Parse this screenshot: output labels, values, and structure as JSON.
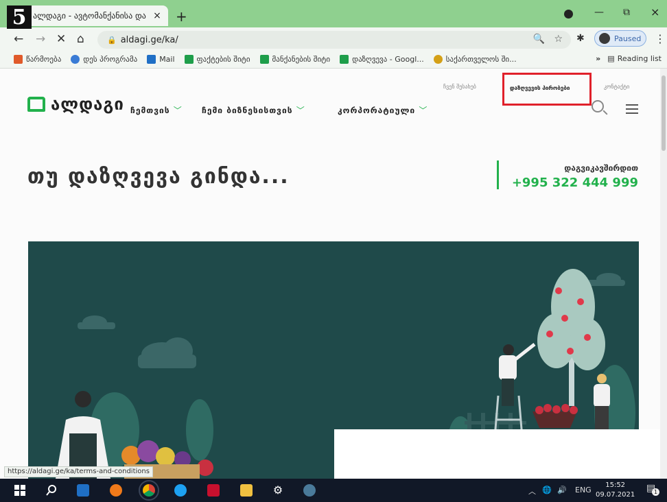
{
  "step_badge": "5",
  "browser": {
    "tab_title": "ალდაგი - ავტომანქანისა და",
    "tab_close": "×",
    "new_tab": "+",
    "url": "aldagi.ge/ka/",
    "profile_status": "Paused",
    "window_min": "—",
    "window_max": "⧉",
    "window_close": "×"
  },
  "bookmarks": {
    "items": [
      {
        "label": "წარმოება",
        "color": "#e05a2a"
      },
      {
        "label": "დეს პროგრამა",
        "color": "#3a7bd5"
      },
      {
        "label": "Mail",
        "color": "#1f6fc5"
      },
      {
        "label": "ფაქტების შიტი",
        "color": "#1e9e4a"
      },
      {
        "label": "მანქანების შიტი",
        "color": "#1e9e4a"
      },
      {
        "label": "დაზღვევა - Googl...",
        "color": "#1e9e4a"
      },
      {
        "label": "საქართველოს ში...",
        "color": "#d4a017"
      }
    ],
    "more": "»",
    "reading_list": "Reading list"
  },
  "site": {
    "top_links": {
      "about": "ჩვენ შესახებ",
      "terms": "დაზღვევის პირობები",
      "contact": "კონტაქტი"
    },
    "logo_text": "ალდაგი",
    "nav": [
      {
        "label": "ჩემთვის"
      },
      {
        "label": "ჩემი ბიზნესისთვის"
      },
      {
        "label": "კორპორატიული"
      }
    ],
    "headline": "თუ დაზღვევა გინდა...",
    "contact_label": "დაგვიკავშირდით",
    "phone": "+995 322 444 999",
    "accent_color": "#22b14c"
  },
  "status_url": "https://aldagi.ge/ka/terms-and-conditions",
  "taskbar": {
    "lang": "ENG",
    "time": "15:52",
    "date": "09.07.2021",
    "notifications": "1"
  }
}
